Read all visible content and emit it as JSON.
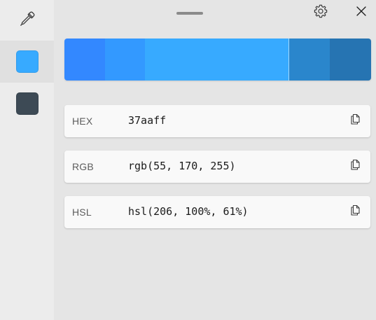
{
  "sidebar": {
    "picker_icon": "eyedropper-icon",
    "history": [
      {
        "color": "#37aaff",
        "selected": true
      },
      {
        "color": "#3d4a55",
        "selected": false
      }
    ]
  },
  "toolbar": {
    "settings_icon": "gear-icon",
    "close_icon": "close-icon"
  },
  "shades": {
    "darker_2": "#2674b2",
    "darker_1": "#2a86cc",
    "main": "#37aaff",
    "lighter_1": "#3399ff",
    "lighter_2": "#3388ff"
  },
  "formats": {
    "hex": {
      "label": "HEX",
      "value": "37aaff"
    },
    "rgb": {
      "label": "RGB",
      "value": "rgb(55, 170, 255)"
    },
    "hsl": {
      "label": "HSL",
      "value": "hsl(206, 100%, 61%)"
    }
  },
  "copy_icon": "copy-icon"
}
